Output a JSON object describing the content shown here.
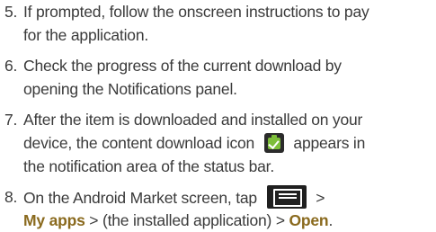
{
  "steps": [
    {
      "number": "5.",
      "lines": [
        "If prompted, follow the onscreen instructions to pay",
        "for the application."
      ]
    },
    {
      "number": "6.",
      "lines": [
        "Check the progress of the current download by",
        "opening the Notifications panel."
      ]
    },
    {
      "number": "7.",
      "line1": "After the item is downloaded and installed on your",
      "line2_before": "device, the content download icon",
      "icon": "content-download-icon",
      "line2_after": "appears in",
      "line3": "the notification area of the status bar."
    },
    {
      "number": "8.",
      "line1_before": "On the Android Market screen, tap",
      "icon": "menu-icon",
      "line1_after": ">",
      "line2_bold1": "My apps",
      "line2_sep1": " > (the installed application) > ",
      "line2_bold2": "Open",
      "line2_end": "."
    }
  ],
  "colors": {
    "text": "#3a3a3a",
    "bold_text": "#8a6a1e",
    "icon_green": "#7dbe3a",
    "icon_dark": "#2b2b2b"
  }
}
